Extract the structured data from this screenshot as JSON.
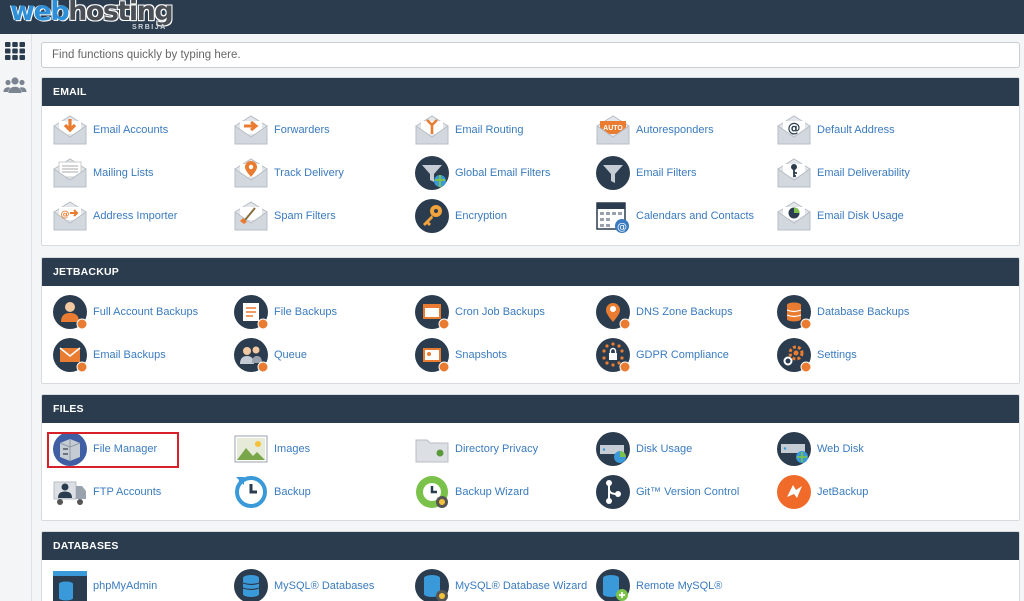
{
  "brand": {
    "logo_web": "web",
    "logo_hosting": "hosting",
    "logo_sub": "SRBIJA",
    "header_color": "#2b3c4e",
    "accent": "#3a7bbf"
  },
  "sidebar": {
    "items": [
      {
        "icon": "grid-icon"
      },
      {
        "icon": "users-icon"
      }
    ]
  },
  "search": {
    "placeholder": "Find functions quickly by typing here."
  },
  "sections": [
    {
      "title": "EMAIL",
      "items": [
        {
          "label": "Email Accounts",
          "icon": "email-accounts-icon"
        },
        {
          "label": "Forwarders",
          "icon": "forwarders-icon"
        },
        {
          "label": "Email Routing",
          "icon": "email-routing-icon"
        },
        {
          "label": "Autoresponders",
          "icon": "autoresponders-icon"
        },
        {
          "label": "Default Address",
          "icon": "default-address-icon"
        },
        {
          "label": "Mailing Lists",
          "icon": "mailing-lists-icon"
        },
        {
          "label": "Track Delivery",
          "icon": "track-delivery-icon"
        },
        {
          "label": "Global Email Filters",
          "icon": "global-email-filters-icon"
        },
        {
          "label": "Email Filters",
          "icon": "email-filters-icon"
        },
        {
          "label": "Email Deliverability",
          "icon": "email-deliverability-icon"
        },
        {
          "label": "Address Importer",
          "icon": "address-importer-icon"
        },
        {
          "label": "Spam Filters",
          "icon": "spam-filters-icon"
        },
        {
          "label": "Encryption",
          "icon": "encryption-icon"
        },
        {
          "label": "Calendars and Contacts",
          "icon": "calendars-contacts-icon"
        },
        {
          "label": "Email Disk Usage",
          "icon": "email-disk-usage-icon"
        }
      ]
    },
    {
      "title": "JETBACKUP",
      "items": [
        {
          "label": "Full Account Backups",
          "icon": "full-account-backups-icon"
        },
        {
          "label": "File Backups",
          "icon": "file-backups-icon"
        },
        {
          "label": "Cron Job Backups",
          "icon": "cron-job-backups-icon"
        },
        {
          "label": "DNS Zone Backups",
          "icon": "dns-zone-backups-icon"
        },
        {
          "label": "Database Backups",
          "icon": "database-backups-icon"
        },
        {
          "label": "Email Backups",
          "icon": "email-backups-icon"
        },
        {
          "label": "Queue",
          "icon": "queue-icon"
        },
        {
          "label": "Snapshots",
          "icon": "snapshots-icon"
        },
        {
          "label": "GDPR Compliance",
          "icon": "gdpr-compliance-icon"
        },
        {
          "label": "Settings",
          "icon": "settings-icon"
        }
      ]
    },
    {
      "title": "FILES",
      "items": [
        {
          "label": "File Manager",
          "icon": "file-manager-icon"
        },
        {
          "label": "Images",
          "icon": "images-icon"
        },
        {
          "label": "Directory Privacy",
          "icon": "directory-privacy-icon"
        },
        {
          "label": "Disk Usage",
          "icon": "disk-usage-icon"
        },
        {
          "label": "Web Disk",
          "icon": "web-disk-icon"
        },
        {
          "label": "FTP Accounts",
          "icon": "ftp-accounts-icon"
        },
        {
          "label": "Backup",
          "icon": "backup-icon"
        },
        {
          "label": "Backup Wizard",
          "icon": "backup-wizard-icon"
        },
        {
          "label": "Git™ Version Control",
          "icon": "git-version-control-icon"
        },
        {
          "label": "JetBackup",
          "icon": "jetbackup-icon"
        }
      ]
    },
    {
      "title": "DATABASES",
      "items": [
        {
          "label": "phpMyAdmin",
          "icon": "phpmyadmin-icon"
        },
        {
          "label": "MySQL® Databases",
          "icon": "mysql-databases-icon"
        },
        {
          "label": "MySQL® Database Wizard",
          "icon": "mysql-database-wizard-icon"
        },
        {
          "label": "Remote MySQL®",
          "icon": "remote-mysql-icon"
        }
      ]
    }
  ]
}
